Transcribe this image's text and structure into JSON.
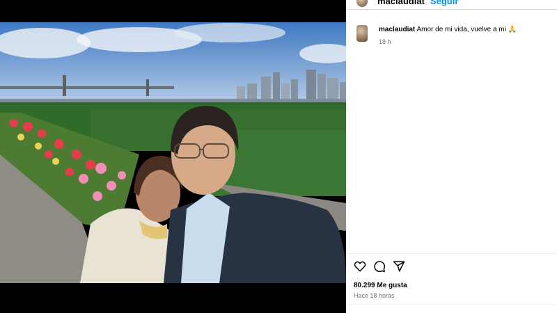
{
  "post": {
    "author": "maclaudiat",
    "follow_label": "Seguir",
    "caption": "Amor de mi vida, vuelve a mi 🙏",
    "caption_time": "18 h",
    "likes_count": "80.299",
    "likes_label": "Me gusta",
    "posted_ago": "Hace 18 horas"
  },
  "actions": {
    "like_icon": "heart-icon",
    "comment_icon": "comment-icon",
    "share_icon": "share-icon"
  },
  "colors": {
    "accent": "#0095f6",
    "muted_text": "#737373",
    "divider": "#dbdbdb"
  }
}
